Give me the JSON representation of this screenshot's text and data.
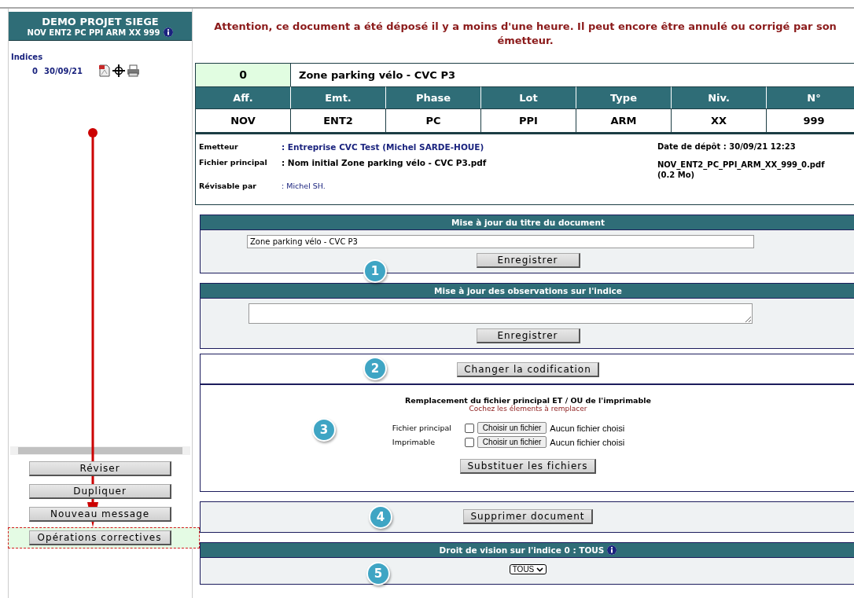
{
  "sidebar": {
    "project": "DEMO PROJET SIEGE",
    "code": "NOV ENT2 PC PPI ARM XX 999",
    "indices_label": "Indices",
    "indices": [
      {
        "index": "0",
        "date": "30/09/21"
      }
    ],
    "buttons": [
      {
        "label": "Réviser",
        "selected": false
      },
      {
        "label": "Dupliquer",
        "selected": false
      },
      {
        "label": "Nouveau message",
        "selected": false
      },
      {
        "label": "Opérations correctives",
        "selected": true
      }
    ]
  },
  "notice": "Attention, ce document a été déposé il y a moins d'une heure. Il peut encore être annulé ou corrigé par son émetteur.",
  "document": {
    "index": "0",
    "title": "Zone parking vélo - CVC P3",
    "columns": [
      {
        "header": "Aff.",
        "value": "NOV"
      },
      {
        "header": "Emt.",
        "value": "ENT2"
      },
      {
        "header": "Phase",
        "value": "PC"
      },
      {
        "header": "Lot",
        "value": "PPI"
      },
      {
        "header": "Type",
        "value": "ARM"
      },
      {
        "header": "Niv.",
        "value": "XX"
      },
      {
        "header": "N°",
        "value": "999"
      }
    ],
    "info": [
      {
        "label": "Emetteur",
        "value": ": Entreprise CVC Test (Michel SARDE-HOUE)",
        "kind": "link"
      },
      {
        "label": "Fichier principal",
        "value": ": Nom initial Zone parking vélo - CVC P3.pdf",
        "kind": "bold"
      },
      {
        "label": "Révisable par",
        "value": ": Michel SH.",
        "kind": "plain"
      }
    ],
    "deposit": "Date de dépôt  :  30/09/21 12:23",
    "file_name": "NOV_ENT2_PC_PPI_ARM_XX_999_0.pdf",
    "file_size": "(0.2 Mo)"
  },
  "title_section": {
    "heading": "Mise à jour du titre du document",
    "value": "Zone parking vélo - CVC P3",
    "button": "Enregistrer",
    "marker": "1"
  },
  "observations_section": {
    "heading": "Mise à jour des observations sur l'indice",
    "button": "Enregistrer"
  },
  "codification_section": {
    "button": "Changer la codification",
    "marker": "2"
  },
  "replace_section": {
    "heading": "Remplacement du fichier principal ET / OU de l'imprimable",
    "hint": "Cochez les élements à remplacer",
    "marker": "3",
    "files": [
      {
        "label": "Fichier principal",
        "checked": false,
        "choose": "Choisir un fichier",
        "status": "Aucun fichier choisi"
      },
      {
        "label": "Imprimable",
        "checked": false,
        "choose": "Choisir un fichier",
        "status": "Aucun fichier choisi"
      }
    ],
    "button": "Substituer les fichiers"
  },
  "delete_section": {
    "button": "Supprimer document",
    "marker": "4"
  },
  "vision_section": {
    "heading": "Droit de vision sur l'indice 0  :  TOUS",
    "select": "TOUS",
    "marker": "5"
  }
}
